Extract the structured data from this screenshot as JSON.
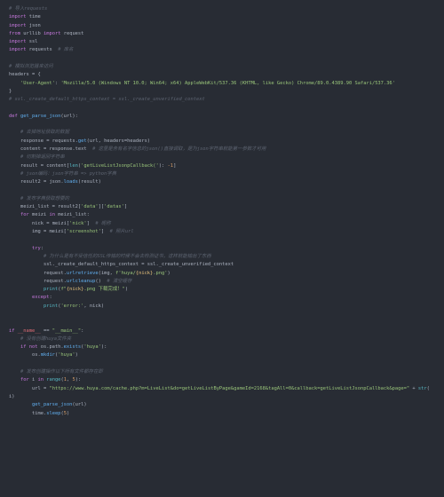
{
  "cmt_ln1": "# 导入requests",
  "l2_kw1": "import",
  "l2_mod": "time",
  "l3_kw1": "import",
  "l3_mod": "json",
  "l4_kw1": "from",
  "l4_mod1": "urllib",
  "l4_kw2": "import",
  "l4_mod2": "request",
  "l5_kw1": "import",
  "l5_mod": "ssl",
  "l6_kw1": "import",
  "l6_mod": "requests",
  "l6_c": "  # 库名",
  "cmt_ln8": "# 模拟浏览器来访问",
  "l9_id": "headers",
  "l9_op": " = {",
  "l10_key": "    'User-Agent'",
  "l10_col": ": ",
  "l10_val": "'Mozilla/5.0 (Windows NT 10.0; Win64; x64) AppleWebKit/537.36 (KHTML, like Gecko) Chrome/89.0.4389.90 Safari/537.36'",
  "l11_cl": "}",
  "cmt_ln12": "# ssl._create_default_https_context = ssl._create_unverified_context",
  "l14_kw": "def ",
  "l14_fn": "get_parse_json",
  "l14_par": "(url):",
  "cmt_ln16": "    # 去掉地址获取的数据",
  "l17_id": "    response",
  "l17_op": " = requests.",
  "l17_fn": "get",
  "l17_par": "(url, headers=headers)",
  "l18_id": "    content",
  "l18_op": " = response.text",
  "l18_c": "  # 这里是含有名字信息的json()直接调取，是为json字符串就能第一参数才可用",
  "cmt_ln19": "    # 切割掉返回字符串",
  "l20_id": "    result",
  "l20_op": " = content[",
  "l20_fn": "len",
  "l20_par": "(",
  "l20_s": "'getLiveListJsonpCallback('",
  "l20_tail": "): ",
  "l20_n": "-1",
  "l20_cl": "]",
  "cmt_ln21": "    # json编码：json字符串 => python字典",
  "l22_id": "    result2",
  "l22_op": " = json.",
  "l22_fn": "loads",
  "l22_par": "(result)",
  "cmt_ln24": "    # 发布字典获取想要的",
  "l25_id": "    meizi_list",
  "l25_op": " = result2[",
  "l25_s1": "'data'",
  "l25_mid": "][",
  "l25_s2": "'datas'",
  "l25_cl": "]",
  "l26_kw": "    for ",
  "l26_id1": "meizi",
  "l26_kw2": " in ",
  "l26_id2": "meizi_list:",
  "l27_id": "        nick",
  "l27_op": " = meizi[",
  "l27_s": "'nick'",
  "l27_cl": "]",
  "l27_c": "  # 昵称",
  "l28_id": "        img",
  "l28_op": " = meizi[",
  "l28_s": "'screenshot'",
  "l28_cl": "]",
  "l28_c": "  # 照片url",
  "l30_kw": "        try",
  "l30_col": ":",
  "cmt_ln31": "            # 为什么是有不受信任的SSL传输的时候不会去检测证书，这样就能输出了东西",
  "l32_id": "            ssl._create_default_https_context",
  "l32_op": " = ssl._create_unverified_context",
  "l33_id": "            request.",
  "l33_fn": "urlretrieve",
  "l33_par": "(img, ",
  "l33_s1": "f'huya/",
  "l33_exp": "{nick}",
  "l33_s2": ".png'",
  "l33_cl": ")",
  "l34_id": "            request.",
  "l34_fn": "urlcleanup",
  "l34_par": "()",
  "l34_c": "  # 清空缓存",
  "l35_fn": "            print",
  "l35_par": "(",
  "l35_s1": "f\"",
  "l35_exp": "{nick}",
  "l35_s2": ".png 下载完成！\"",
  "l35_cl": ")",
  "l36_kw": "        except",
  "l36_col": ":",
  "l37_fn": "            print",
  "l37_par": "(",
  "l37_s": "'error:'",
  "l37_mid": ", nick)",
  "l40_kw": "if ",
  "l40_id": "__name__",
  "l40_op": " == ",
  "l40_s": "\"__main__\"",
  "l40_col": ":",
  "cmt_ln41": "    # 没有创建huya文件夹",
  "l42_kw": "    if not ",
  "l42_id": "os.path.",
  "l42_fn": "exists",
  "l42_par": "(",
  "l42_s": "'huya'",
  "l42_cl": "):",
  "l43_id": "        os.",
  "l43_fn": "mkdir",
  "l43_par": "(",
  "l43_s": "'huya'",
  "l43_cl": ")",
  "cmt_ln45": "    # 发布创建操作以下所有文件都存在即",
  "l46_kw": "    for ",
  "l46_id1": "i",
  "l46_kw2": " in ",
  "l46_fn": "range",
  "l46_par": "(",
  "l46_n1": "1",
  "l46_mid": ", ",
  "l46_n2": "5",
  "l46_cl": "):",
  "l47_id": "        url",
  "l47_op": " = ",
  "l47_s": "\"https://www.huya.com/cache.php?m=LiveList&do=getLiveListByPage&gameId=2168&tagAll=0&callback=getLiveListJsonpCallback&page=\"",
  "l47_tail": " + ",
  "l47_fn": "str",
  "l47_par": "(",
  "l48_id": "i)",
  "l49_fn": "        get_parse_json",
  "l49_par": "(url)",
  "l50_id": "        time.",
  "l50_fn": "sleep",
  "l50_par": "(",
  "l50_n": "5",
  "l50_cl": ")"
}
